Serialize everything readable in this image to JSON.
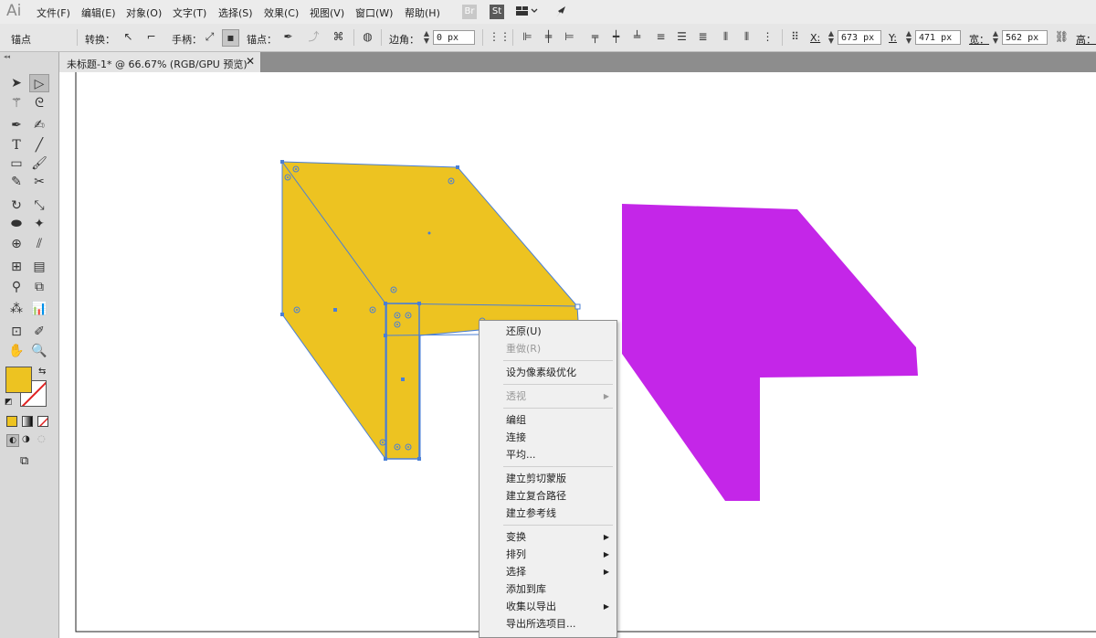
{
  "app": {
    "logo": "Ai"
  },
  "menubar": {
    "items": [
      "文件(F)",
      "编辑(E)",
      "对象(O)",
      "文字(T)",
      "选择(S)",
      "效果(C)",
      "视图(V)",
      "窗口(W)",
      "帮助(H)"
    ],
    "br_label": "Br",
    "st_label": "St"
  },
  "controlbar": {
    "mode_label": "锚点",
    "convert_label": "转换：",
    "handles_label": "手柄：",
    "anchor_label": "锚点：",
    "corner_label": "边角：",
    "corner_value": "0 px",
    "x_label": "X:",
    "x_value": "673 px",
    "y_label": "Y:",
    "y_value": "471 px",
    "w_label": "宽：",
    "w_value": "562 px",
    "h_label": "高："
  },
  "document": {
    "tab_title": "未标题-1* @ 66.67% (RGB/GPU 预览)"
  },
  "colors": {
    "fill": "#edc321",
    "purple": "#c426e8",
    "selection": "#4a7fd6"
  },
  "context_menu": {
    "undo": "还原(U)",
    "redo": "重做(R)",
    "pixel_optimize": "设为像素级优化",
    "perspective": "透视",
    "group": "编组",
    "join": "连接",
    "average": "平均...",
    "clipping_mask": "建立剪切蒙版",
    "compound_path": "建立复合路径",
    "guides": "建立参考线",
    "transform": "变换",
    "arrange": "排列",
    "select": "选择",
    "add_to_library": "添加到库",
    "collect_export": "收集以导出",
    "export_selected": "导出所选项目..."
  }
}
